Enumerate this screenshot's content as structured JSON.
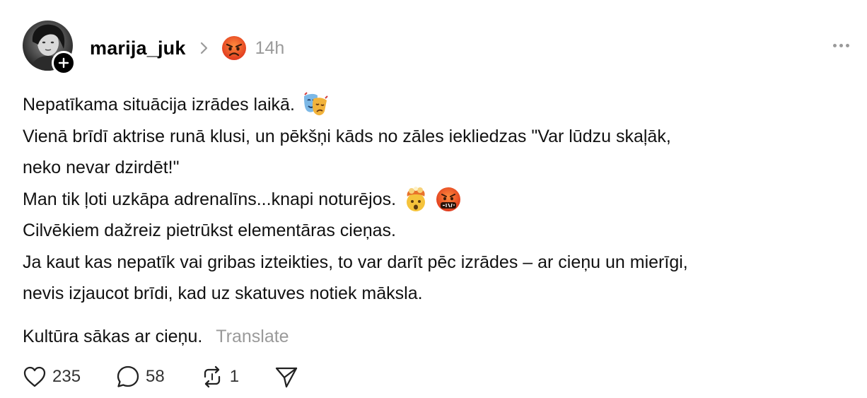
{
  "author": {
    "username": "marija_juk",
    "time": "14h"
  },
  "post": {
    "lines": [
      "Nepatīkama situācija izrādes laikā.",
      "Vienā brīdī aktrise runā klusi, un pēkšņi kāds no zāles iekliedzas \"Var lūdzu skaļāk,",
      "neko nevar dzirdēt!\"",
      "Man tik ļoti uzkāpa adrenalīns...knapi noturējos.",
      "Cilvēkiem dažreiz pietrūkst elementāras cieņas.",
      "Ja kaut kas nepatīk vai gribas izteikties, to var darīt pēc izrādes – ar cieņu un mierīgi,",
      "nevis izjaucot brīdi, kad uz skatuves notiek māksla."
    ],
    "closing": "Kultūra sākas ar cieņu.",
    "translate_label": "Translate"
  },
  "actions": {
    "likes": "235",
    "replies": "58",
    "reposts": "1"
  },
  "icons": {
    "status_emoji": "angry-face-emoji",
    "line1_emoji": "performing-arts-emoji",
    "line4_emojis": [
      "exploding-head-emoji",
      "face-with-symbols-emoji"
    ]
  },
  "colors": {
    "muted": "#9a9a9a",
    "text": "#111111"
  }
}
